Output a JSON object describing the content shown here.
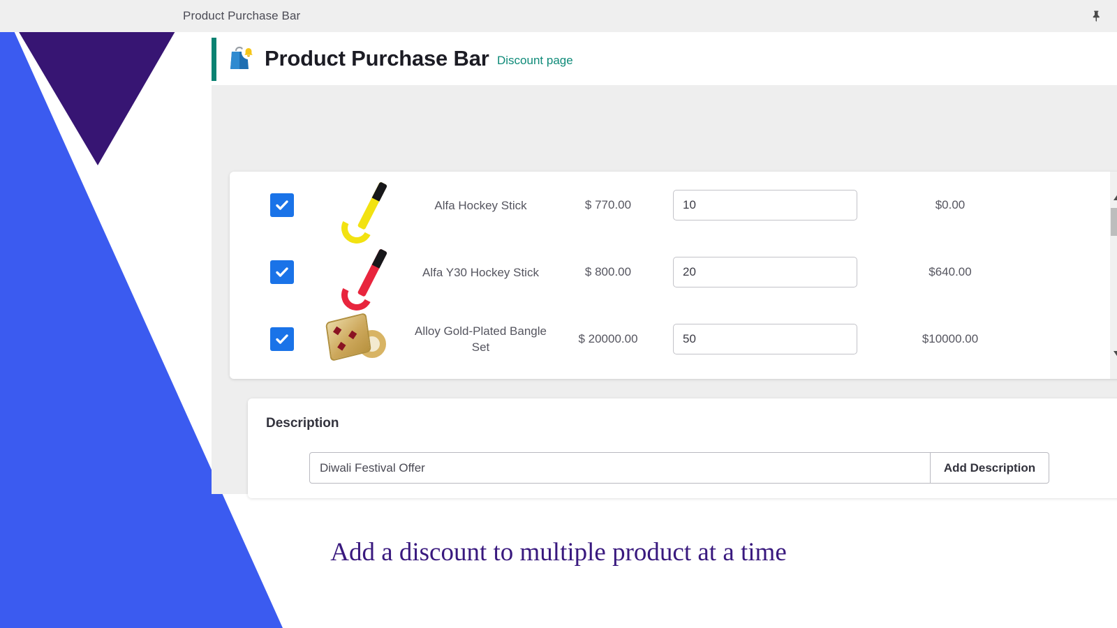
{
  "window": {
    "title": "Product Purchase Bar",
    "pin_icon": "pushpin-icon"
  },
  "app": {
    "title": "Product Purchase Bar",
    "subtitle": "Discount page",
    "logo_icon": "shopping-bag-bell-icon",
    "accent_color": "#0a8272"
  },
  "products": [
    {
      "checked": true,
      "image_icon": "yellow-hockey-stick-image",
      "name": "Alfa Hockey Stick",
      "price": "$ 770.00",
      "quantity": "10",
      "discount": "$0.00"
    },
    {
      "checked": true,
      "image_icon": "red-hockey-stick-image",
      "name": "Alfa Y30 Hockey Stick",
      "price": "$ 800.00",
      "quantity": "20",
      "discount": "$640.00"
    },
    {
      "checked": true,
      "image_icon": "gold-bangle-set-image",
      "name": "Alloy Gold-Plated Bangle Set",
      "price": "$ 20000.00",
      "quantity": "50",
      "discount": "$10000.00"
    }
  ],
  "scrollbar": {
    "up_arrow": "triangle-up-icon",
    "down_arrow": "triangle-down-icon"
  },
  "description": {
    "label": "Description",
    "value": "Diwali Festival Offer",
    "placeholder": "",
    "button_label": "Add Description"
  },
  "caption": "Add a discount to multiple product at a time",
  "colors": {
    "deco_purple": "#371573",
    "deco_blue": "#3b5bf0",
    "checkbox_blue": "#1a73e8",
    "titlebar_bg": "#efefef",
    "content_bg": "#eeeeee",
    "caption_purple": "#39197e"
  }
}
